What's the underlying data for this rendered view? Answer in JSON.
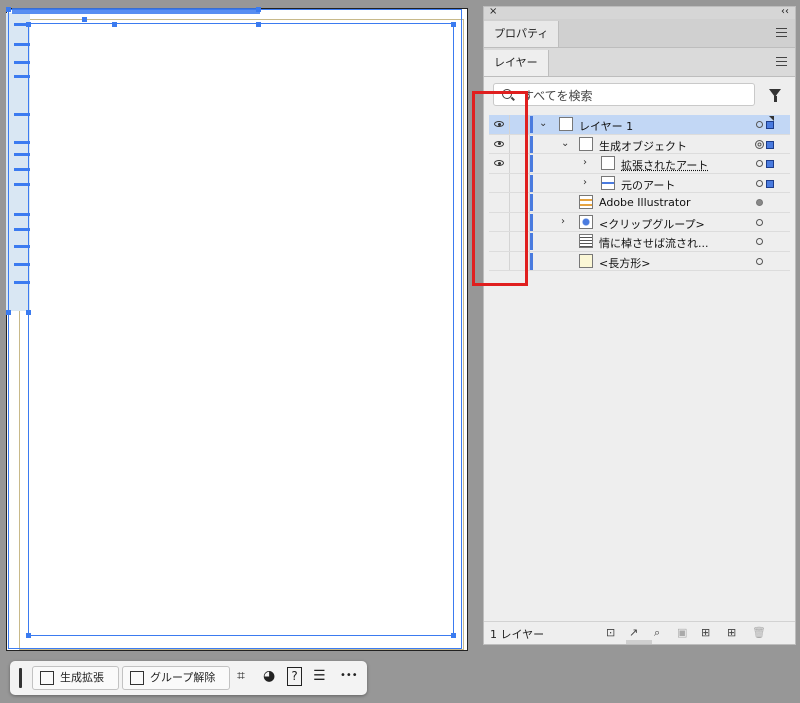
{
  "panel": {
    "close_glyph": "×",
    "collapse_glyph": "‹‹",
    "properties_tab": "プロパティ",
    "layers_tab": "レイヤー",
    "search": {
      "placeholder": "すべてを検索"
    },
    "layers": [
      {
        "name": "レイヤー 1",
        "eye": true,
        "expanded": true,
        "selected": true
      },
      {
        "name": "生成オブジェクト",
        "eye": true,
        "expanded": true
      },
      {
        "name": "拡張されたアート",
        "eye": true,
        "expanded": false
      },
      {
        "name": "元のアート",
        "eye": false,
        "expanded": false
      },
      {
        "name": "Adobe  Illustrator",
        "eye": false
      },
      {
        "name": "<クリップグループ>",
        "eye": false,
        "expanded": false
      },
      {
        "name": "情に棹させば流され...",
        "eye": false
      },
      {
        "name": "<長方形>",
        "eye": false
      }
    ],
    "footer": {
      "count_label": "1 レイヤー"
    }
  },
  "taskbar": {
    "generative_expand": "生成拡張",
    "ungroup": "グループ解除",
    "help_glyph": "?",
    "more_glyph": "•••"
  },
  "colors": {
    "selection_blue": "#3b7bf0",
    "layer_color": "#4a7bdf",
    "highlight_red": "#e01f1f"
  }
}
